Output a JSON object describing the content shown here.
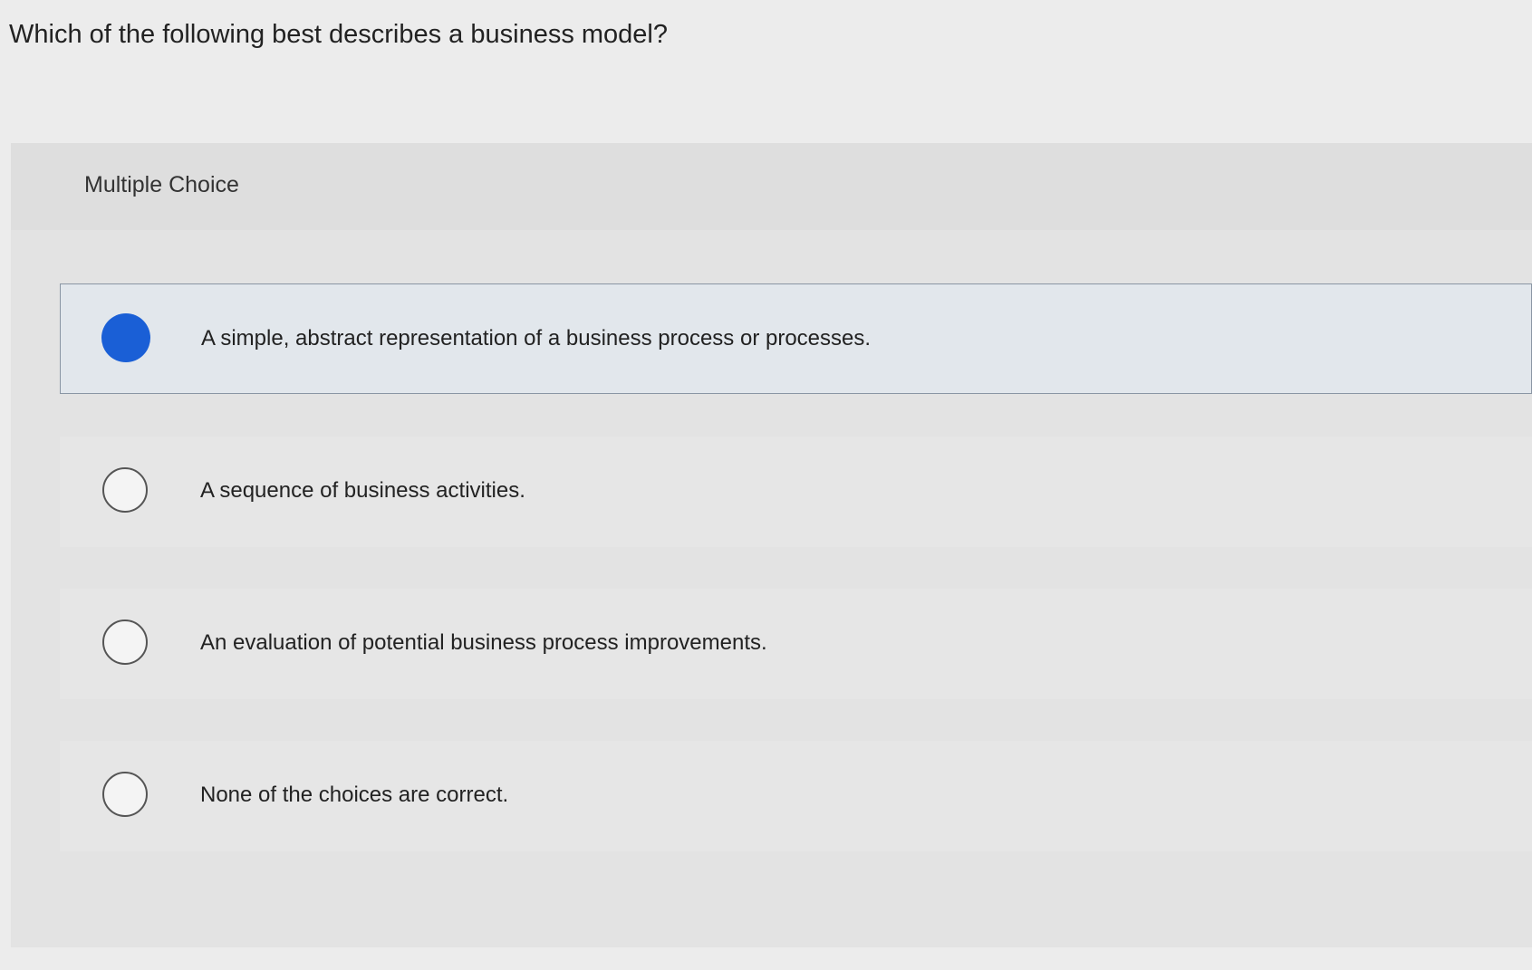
{
  "question": {
    "text": "Which of the following best describes a business model?"
  },
  "panel": {
    "type_label": "Multiple Choice"
  },
  "choices": [
    {
      "text": "A simple, abstract representation of a business process or processes.",
      "selected": true
    },
    {
      "text": "A sequence of business activities.",
      "selected": false
    },
    {
      "text": "An evaluation of potential business process improvements.",
      "selected": false
    },
    {
      "text": "None of the choices are correct.",
      "selected": false
    }
  ],
  "colors": {
    "selected_radio": "#1a5fd6"
  }
}
